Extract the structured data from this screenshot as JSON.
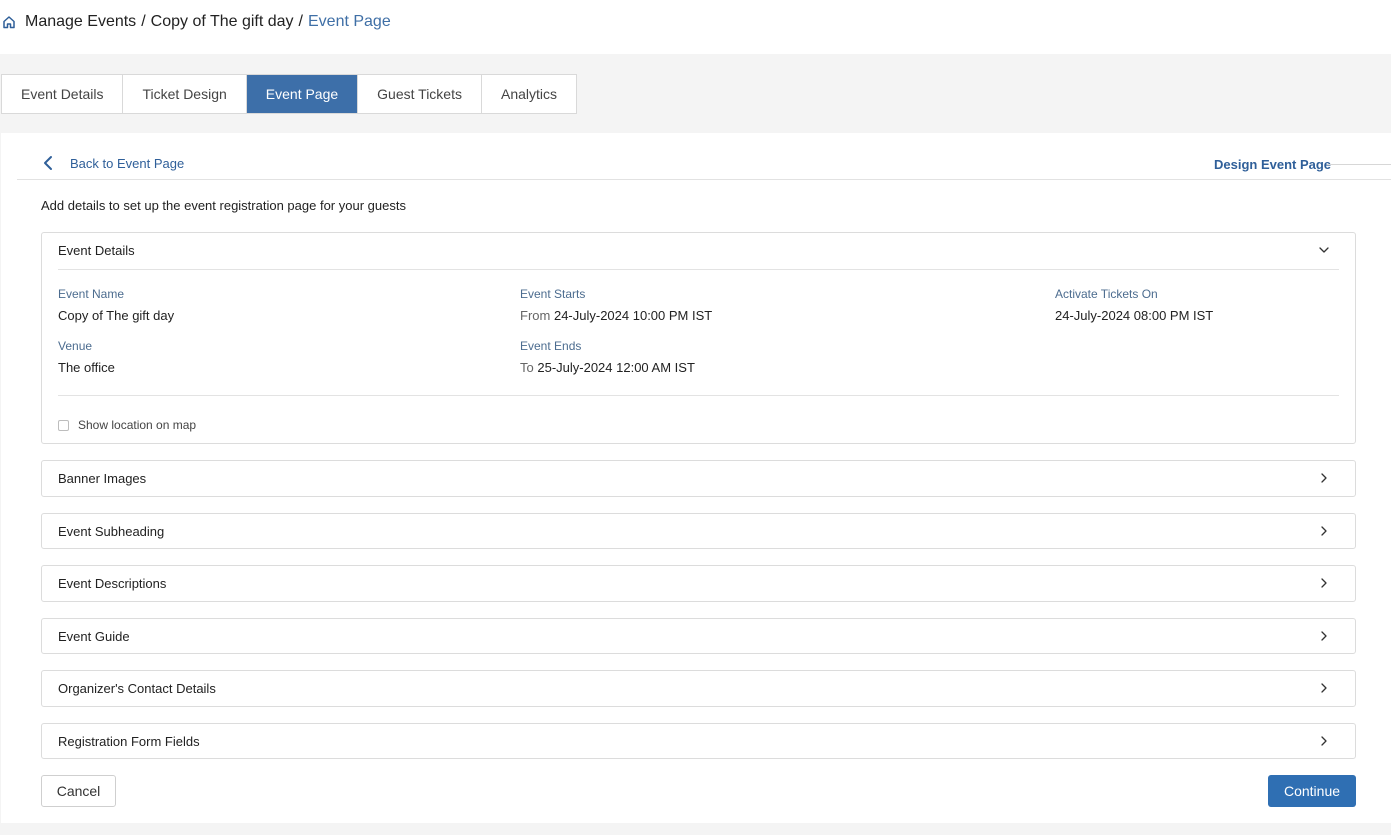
{
  "breadcrumb": {
    "icon": "home-icon",
    "items": [
      "Manage Events",
      "Copy of The gift day"
    ],
    "separator": "/",
    "current": "Event Page"
  },
  "tabs": [
    {
      "label": "Event Details",
      "active": false
    },
    {
      "label": "Ticket Design",
      "active": false
    },
    {
      "label": "Event Page",
      "active": true
    },
    {
      "label": "Guest Tickets",
      "active": false
    },
    {
      "label": "Analytics",
      "active": false
    }
  ],
  "subheader": {
    "back_label": "Back to Event Page",
    "design_title": "Design Event Page"
  },
  "intro": "Add details to set up the event registration page for your guests",
  "event_details": {
    "title": "Event Details",
    "expanded": true,
    "event_name_label": "Event Name",
    "event_name": "Copy of The gift day",
    "venue_label": "Venue",
    "venue": "The office",
    "starts_label": "Event Starts",
    "starts_prefix": "From",
    "starts_value": "24-July-2024 10:00 PM IST",
    "ends_label": "Event Ends",
    "ends_prefix": "To",
    "ends_value": "25-July-2024 12:00 AM IST",
    "activate_label": "Activate Tickets On",
    "activate_value": "24-July-2024 08:00 PM IST",
    "show_map_label": "Show location on map",
    "show_map_checked": false
  },
  "sections": [
    {
      "title": "Banner Images"
    },
    {
      "title": "Event Subheading"
    },
    {
      "title": "Event Descriptions"
    },
    {
      "title": "Event Guide"
    },
    {
      "title": "Organizer's Contact Details"
    },
    {
      "title": "Registration Form Fields"
    }
  ],
  "actions": {
    "cancel_label": "Cancel",
    "continue_label": "Continue"
  },
  "colors": {
    "accent": "#3d6fa9",
    "link": "#2f5f99",
    "primary_button": "#2f6fb3"
  }
}
